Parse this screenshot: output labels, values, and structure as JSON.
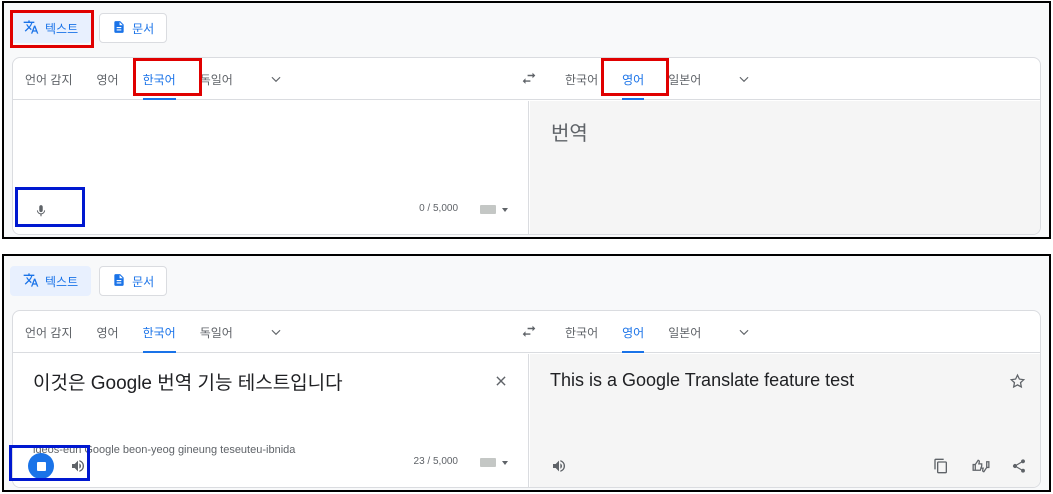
{
  "panels": [
    {
      "modes": [
        {
          "label": "텍스트",
          "active": true,
          "icon": "translate-icon"
        },
        {
          "label": "문서",
          "active": false,
          "icon": "document-icon"
        }
      ],
      "source_langs": [
        "언어 감지",
        "영어",
        "한국어",
        "독일어"
      ],
      "source_selected": "한국어",
      "target_langs": [
        "한국어",
        "영어",
        "일본어"
      ],
      "target_selected": "영어",
      "placeholder": "번역",
      "char_count": "0 / 5,000"
    },
    {
      "modes": [
        {
          "label": "텍스트",
          "active": true,
          "icon": "translate-icon"
        },
        {
          "label": "문서",
          "active": false,
          "icon": "document-icon"
        }
      ],
      "source_langs": [
        "언어 감지",
        "영어",
        "한국어",
        "독일어"
      ],
      "source_selected": "한국어",
      "target_langs": [
        "한국어",
        "영어",
        "일본어"
      ],
      "target_selected": "영어",
      "source_text": "이것은 Google 번역 기능 테스트입니다",
      "transliteration": "igeos-eun Google beon-yeog gineung teseuteu-ibnida",
      "translation": "This is a Google Translate feature test",
      "char_count": "23 / 5,000"
    }
  ],
  "colors": {
    "accent": "#1a73e8",
    "highlight_red": "#e00000",
    "highlight_blue": "#0018d0"
  }
}
